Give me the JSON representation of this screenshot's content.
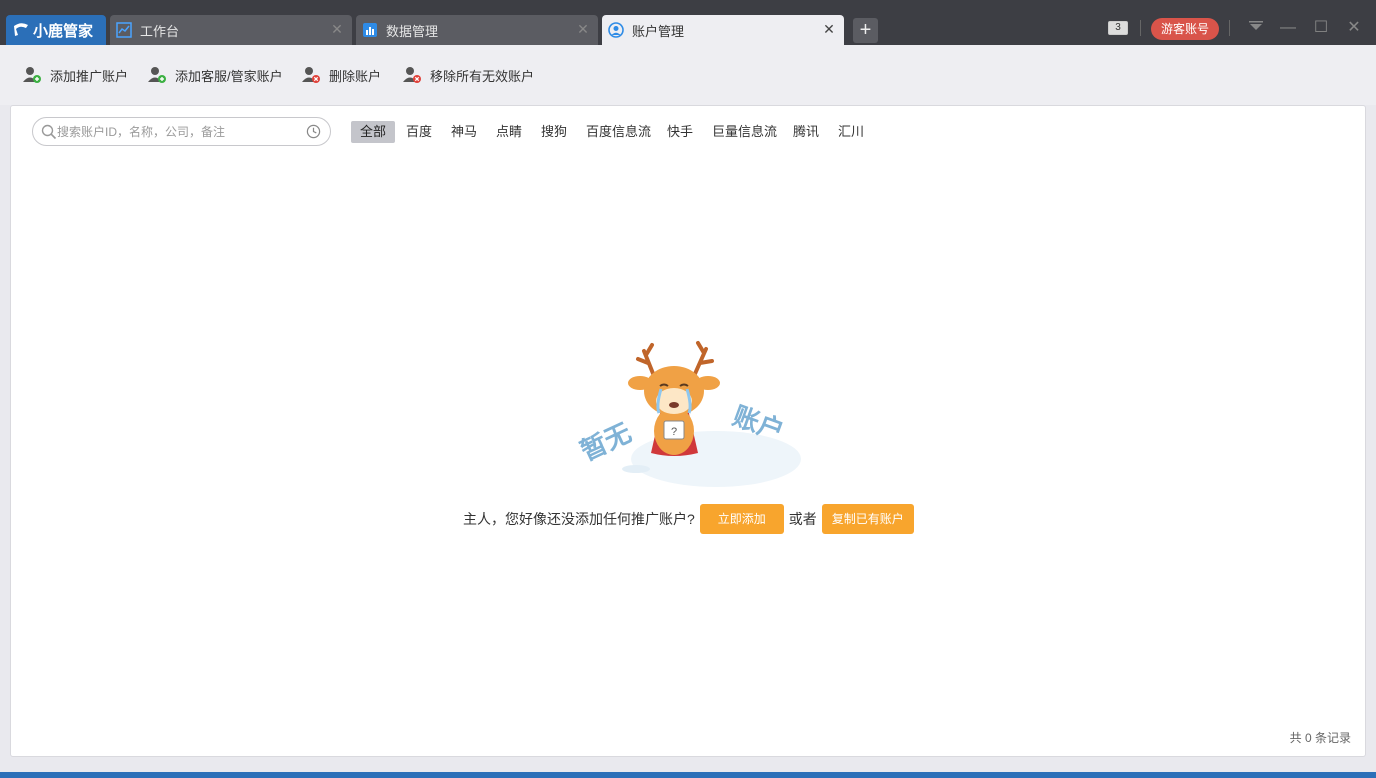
{
  "app": {
    "brand": "小鹿管家",
    "tabs": [
      {
        "label": "工作台",
        "icon": "chart-icon",
        "active": false
      },
      {
        "label": "数据管理",
        "icon": "database-icon",
        "active": false
      },
      {
        "label": "账户管理",
        "icon": "user-circle-icon",
        "active": true
      }
    ],
    "counter": "3",
    "guest_label": "游客账号"
  },
  "toolbar": {
    "add_promo": "添加推广账户",
    "add_service": "添加客服/管家账户",
    "delete": "删除账户",
    "remove_invalid": "移除所有无效账户"
  },
  "search": {
    "placeholder": "搜索账户ID，名称，公司，备注"
  },
  "filters": [
    "全部",
    "百度",
    "神马",
    "点睛",
    "搜狗",
    "百度信息流",
    "快手",
    "巨量信息流",
    "腾讯",
    "汇川"
  ],
  "empty": {
    "illustration_text_left": "暂无",
    "illustration_text_right": "账户",
    "message": "主人，您好像还没添加任何推广账户?",
    "add_now": "立即添加",
    "or": "或者",
    "copy_existing": "复制已有账户"
  },
  "footer": {
    "total": "共 0 条记录"
  },
  "colors": {
    "accent_blue": "#2b6fb8",
    "orange": "#f8a52d",
    "guest_red": "#d9544a"
  }
}
